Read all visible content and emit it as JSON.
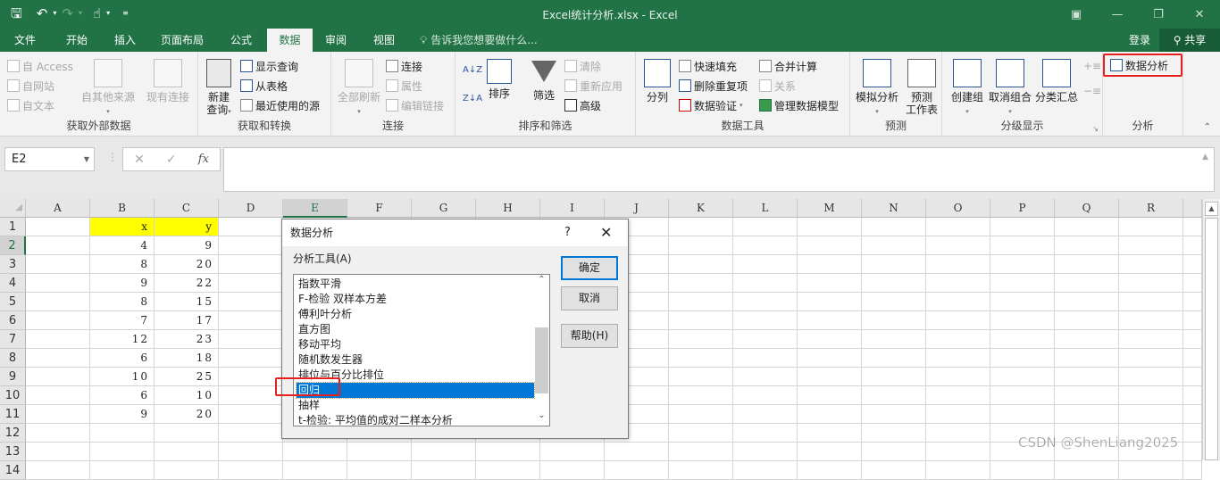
{
  "window": {
    "title": "Excel统计分析.xlsx - Excel",
    "controls": [
      "ribbon-display-icon",
      "minimize-icon",
      "restore-icon",
      "close-icon"
    ]
  },
  "qat": {
    "icons": [
      "save-icon",
      "undo-icon",
      "redo-icon",
      "touch-mode-icon",
      "customize-qat-icon"
    ]
  },
  "tabs": {
    "file": "文件",
    "home": "开始",
    "insert": "插入",
    "layout": "页面布局",
    "formulas": "公式",
    "data": "数据",
    "review": "审阅",
    "view": "视图",
    "tellme": "告诉我您想要做什么...",
    "login": "登录",
    "share": "共享"
  },
  "ribbon": {
    "get_external": {
      "label": "获取外部数据",
      "access": "自 Access",
      "web": "自网站",
      "text": "自文本",
      "other": "自其他来源",
      "existing": "现有连接"
    },
    "get_transform": {
      "label": "获取和转换",
      "new_query_1": "新建",
      "new_query_2": "查询",
      "show_queries": "显示查询",
      "from_table": "从表格",
      "recent_sources": "最近使用的源"
    },
    "connections": {
      "label": "连接",
      "refresh_all": "全部刷新",
      "connections": "连接",
      "properties": "属性",
      "edit_links": "编辑链接"
    },
    "sort_filter": {
      "label": "排序和筛选",
      "sort": "排序",
      "filter": "筛选",
      "clear": "清除",
      "reapply": "重新应用",
      "advanced": "高级"
    },
    "data_tools": {
      "label": "数据工具",
      "text_to_columns": "分列",
      "flash_fill": "快速填充",
      "remove_duplicates": "删除重复项",
      "data_validation": "数据验证",
      "consolidate": "合并计算",
      "relationships": "关系",
      "manage_model": "管理数据模型"
    },
    "forecast": {
      "label": "预测",
      "what_if": "模拟分析",
      "forecast_sheet_1": "预测",
      "forecast_sheet_2": "工作表"
    },
    "outline": {
      "label": "分级显示",
      "group": "创建组",
      "ungroup": "取消组合",
      "subtotal": "分类汇总"
    },
    "analysis": {
      "label": "分析",
      "data_analysis": "数据分析"
    }
  },
  "formula_bar": {
    "name_box": "E2",
    "formula": ""
  },
  "sheet": {
    "columns": [
      "A",
      "B",
      "C",
      "D",
      "E",
      "F",
      "G",
      "H",
      "I",
      "J",
      "K",
      "L",
      "M",
      "N",
      "O",
      "P",
      "Q",
      "R"
    ],
    "selected_column": "E",
    "selected_row": 2,
    "rows": [
      {
        "num": "1",
        "b": "x",
        "c": "y"
      },
      {
        "num": "2",
        "b": "4",
        "c": "9"
      },
      {
        "num": "3",
        "b": "8",
        "c": "20"
      },
      {
        "num": "4",
        "b": "9",
        "c": "22"
      },
      {
        "num": "5",
        "b": "8",
        "c": "15"
      },
      {
        "num": "6",
        "b": "7",
        "c": "17"
      },
      {
        "num": "7",
        "b": "12",
        "c": "23"
      },
      {
        "num": "8",
        "b": "6",
        "c": "18"
      },
      {
        "num": "9",
        "b": "10",
        "c": "25"
      },
      {
        "num": "10",
        "b": "6",
        "c": "10"
      },
      {
        "num": "11",
        "b": "9",
        "c": "20"
      },
      {
        "num": "12",
        "b": "",
        "c": ""
      },
      {
        "num": "13",
        "b": "",
        "c": ""
      },
      {
        "num": "14",
        "b": "",
        "c": ""
      }
    ],
    "header_fill": "#ffff00"
  },
  "dialog": {
    "title": "数据分析",
    "help": "?",
    "close": "✕",
    "tools_label": "分析工具(A)",
    "tools": [
      "指数平滑",
      "F-检验 双样本方差",
      "傅利叶分析",
      "直方图",
      "移动平均",
      "随机数发生器",
      "排位与百分比排位",
      "回归",
      "抽样",
      "t-检验: 平均值的成对二样本分析"
    ],
    "selected_index": 7,
    "ok": "确定",
    "cancel": "取消",
    "help_button": "帮助(H)"
  },
  "watermark": "CSDN @ShenLiang2025",
  "colors": {
    "accent": "#217346",
    "selection": "#0078d7",
    "highlight_box": "#e8201d"
  }
}
